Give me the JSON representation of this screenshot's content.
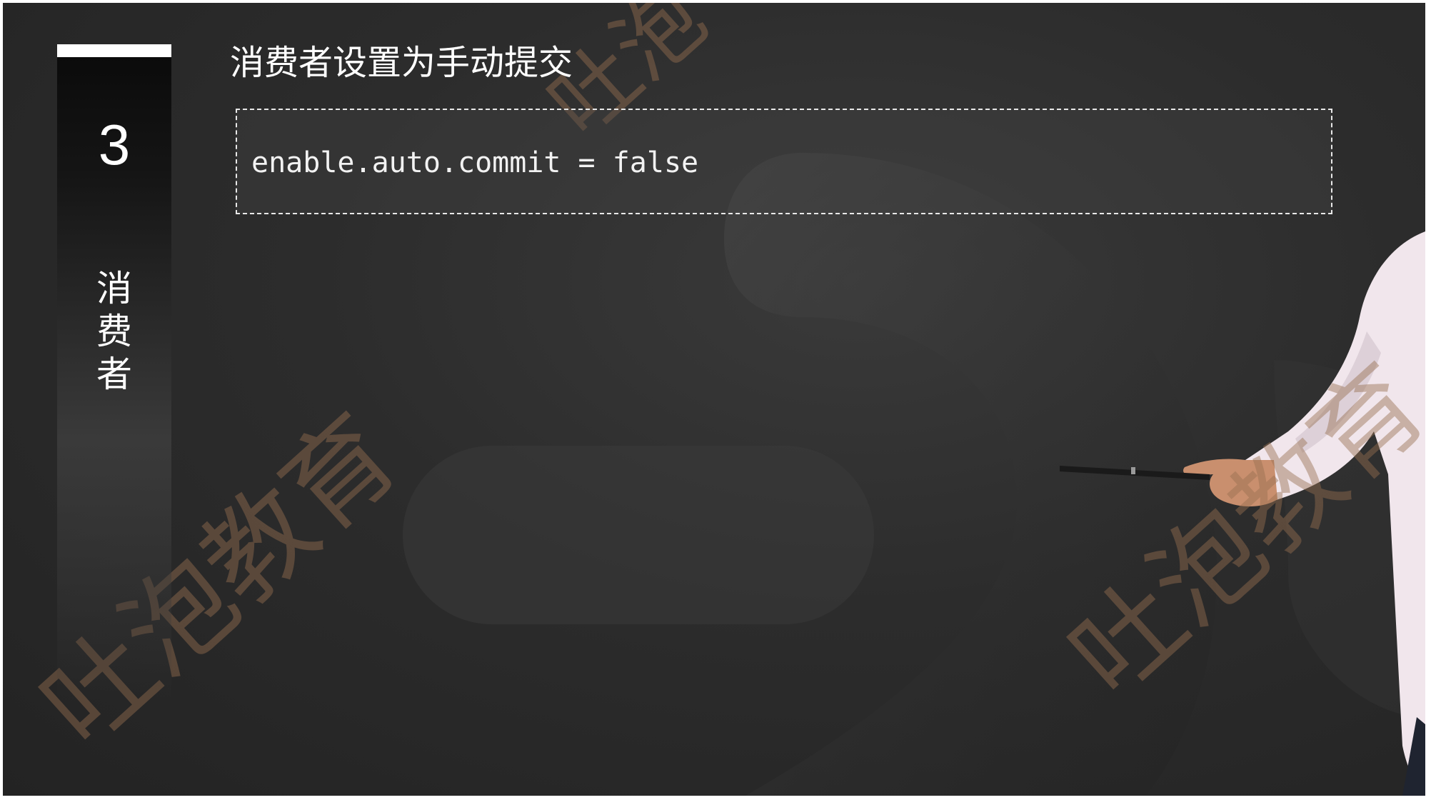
{
  "slide": {
    "section_number": "3",
    "section_label": "消费者",
    "title": "消费者设置为手动提交",
    "code": "enable.auto.commit = false"
  },
  "watermark": {
    "text_1": "吐泡教育",
    "text_2": "吐泡教育",
    "text_3": "吐泡"
  },
  "colors": {
    "background": "#2c2c2c",
    "text": "#ffffff",
    "watermark": "#966e50"
  },
  "icons": {
    "presenter": "presenter-with-pointer"
  }
}
